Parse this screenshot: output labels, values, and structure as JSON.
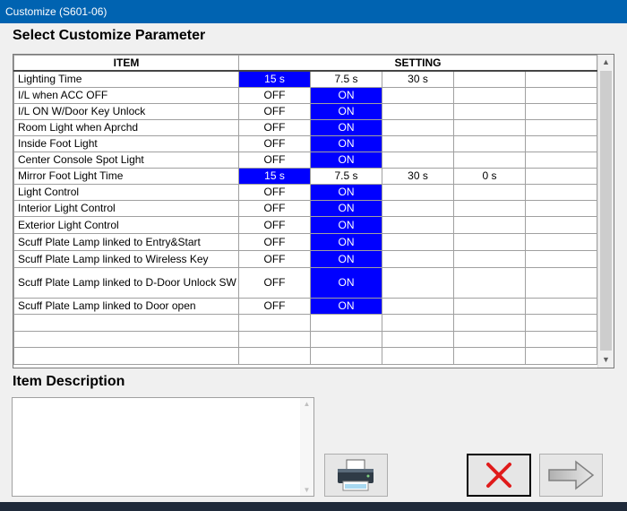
{
  "window": {
    "title": "Customize (S601-06)"
  },
  "section_title": "Select Customize Parameter",
  "columns": {
    "item": "ITEM",
    "setting": "SETTING"
  },
  "rows": [
    {
      "label": "Lighting Time",
      "values": [
        "15 s",
        "7.5 s",
        "30 s",
        "",
        ""
      ],
      "selected": 0
    },
    {
      "label": "I/L when ACC OFF",
      "values": [
        "OFF",
        "ON",
        "",
        "",
        ""
      ],
      "selected": 1
    },
    {
      "label": "I/L ON W/Door Key Unlock",
      "values": [
        "OFF",
        "ON",
        "",
        "",
        ""
      ],
      "selected": 1
    },
    {
      "label": "Room Light when Aprchd",
      "values": [
        "OFF",
        "ON",
        "",
        "",
        ""
      ],
      "selected": 1
    },
    {
      "label": "Inside Foot Light",
      "values": [
        "OFF",
        "ON",
        "",
        "",
        ""
      ],
      "selected": 1
    },
    {
      "label": "Center Console Spot Light",
      "values": [
        "OFF",
        "ON",
        "",
        "",
        ""
      ],
      "selected": 1
    },
    {
      "label": "Mirror Foot Light Time",
      "values": [
        "15 s",
        "7.5 s",
        "30 s",
        "0 s",
        ""
      ],
      "selected": 0
    },
    {
      "label": "Light Control",
      "values": [
        "OFF",
        "ON",
        "",
        "",
        ""
      ],
      "selected": 1
    },
    {
      "label": "Interior Light Control",
      "values": [
        "OFF",
        "ON",
        "",
        "",
        ""
      ],
      "selected": 1
    },
    {
      "label": "Exterior Light Control",
      "values": [
        "OFF",
        "ON",
        "",
        "",
        ""
      ],
      "selected": 1
    },
    {
      "label": "Scuff Plate Lamp linked to Entry&Start",
      "values": [
        "OFF",
        "ON",
        "",
        "",
        ""
      ],
      "selected": 1
    },
    {
      "label": "Scuff Plate Lamp linked to Wireless Key",
      "values": [
        "OFF",
        "ON",
        "",
        "",
        ""
      ],
      "selected": 1
    },
    {
      "label": "Scuff Plate Lamp linked to D-Door Unlock SW",
      "values": [
        "OFF",
        "ON",
        "",
        "",
        ""
      ],
      "selected": 1
    },
    {
      "label": "Scuff Plate Lamp linked to Door open",
      "values": [
        "OFF",
        "ON",
        "",
        "",
        ""
      ],
      "selected": 1
    },
    {
      "label": "",
      "values": [
        "",
        "",
        "",
        "",
        ""
      ],
      "selected": -1
    },
    {
      "label": "",
      "values": [
        "",
        "",
        "",
        "",
        ""
      ],
      "selected": -1
    },
    {
      "label": "",
      "values": [
        "",
        "",
        "",
        "",
        ""
      ],
      "selected": -1
    }
  ],
  "description": {
    "title": "Item Description",
    "text": ""
  },
  "colors": {
    "titlebar": "#0063b1",
    "selected_cell": "#0000ff",
    "cancel_x": "#e01b1b"
  },
  "icons": {
    "print": "printer-icon",
    "cancel": "cancel-x-icon",
    "next": "arrow-right-icon"
  }
}
